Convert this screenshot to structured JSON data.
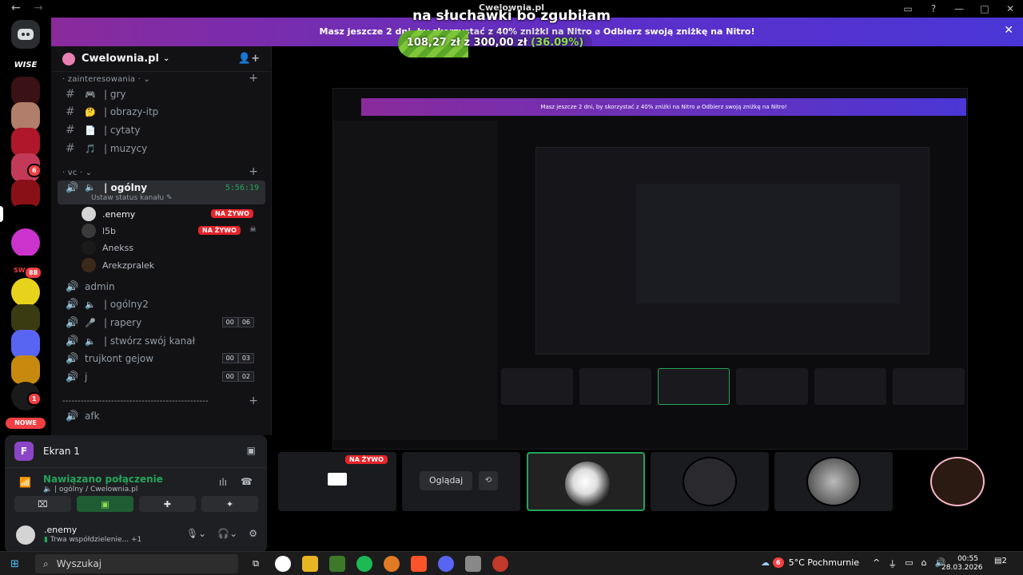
{
  "window": {
    "title": "Cwelownia.pl",
    "back": "←",
    "forward": "→"
  },
  "overlay": {
    "stream_title": "na słuchawki bo zgubiłam",
    "goal_current": "108,27 zł",
    "goal_sep": "z",
    "goal_total": "300,00 zł",
    "goal_percent": "(36.09%)",
    "goal_fraction": 0.3609
  },
  "banner": {
    "text": "Masz jeszcze 2 dni, by skorzystać z 40% zniżki na Nitro   ⌀ Odbierz swoją zniżkę na Nitro!"
  },
  "servers": {
    "wise": "WISE",
    "swigs": "SWIGS",
    "badges": [
      "6",
      "88",
      "1"
    ],
    "nowe": "NOWE"
  },
  "sidebar": {
    "server_name": "Cwelownia.pl",
    "categories": [
      {
        "label": "zainteresowania"
      },
      {
        "label": "vc"
      },
      {
        "label": "------------------------------------------------"
      }
    ],
    "text_channels": [
      {
        "icon": "🎮",
        "label": "| gry"
      },
      {
        "icon": "🤔",
        "label": "| obrazy-itp"
      },
      {
        "icon": "📄",
        "label": "| cytaty"
      },
      {
        "icon": "🎵",
        "label": "| muzycy"
      }
    ],
    "active_voice": {
      "label": "| ogólny",
      "timer": "5:56:19",
      "status": "Ustaw status kanału"
    },
    "voice_users": [
      {
        "name": ".enemy",
        "live": "NA ŻYWO"
      },
      {
        "name": "l5b",
        "live": "NA ŻYWO"
      },
      {
        "name": "Anekss"
      },
      {
        "name": "Arekzpralek"
      }
    ],
    "voice_channels": [
      {
        "label": "admin"
      },
      {
        "label": "| ogólny2"
      },
      {
        "label": "| rapery",
        "count_a": "00",
        "count_b": "06"
      },
      {
        "label": "| stwórz swój kanał"
      },
      {
        "label": "trujkont gejow",
        "count_a": "00",
        "count_b": "03"
      },
      {
        "label": "j",
        "count_a": "00",
        "count_b": "02"
      },
      {
        "label": "afk"
      }
    ]
  },
  "voice_panel": {
    "title": "Ekran 1",
    "connected": "Nawiązano połączenie",
    "channel": "| ogólny / Cwelownia.pl",
    "user_name": ".enemy",
    "user_status": "Trwa współdzielenie... +1"
  },
  "tiles": {
    "live": "NA ŻYWO",
    "watch": "Oglądaj"
  },
  "taskbar": {
    "search": "Wyszukaj",
    "weather": "5°C  Pochmurnie",
    "weather_badge": "6",
    "time": "00:55",
    "date": "28.03.2026",
    "notif": "2"
  },
  "nested": {
    "banner": "Masz jeszcze 2 dni, by skorzystać z 40% zniżki na Nitro   ⌀ Odbierz swoją zniżkę na Nitro!"
  }
}
